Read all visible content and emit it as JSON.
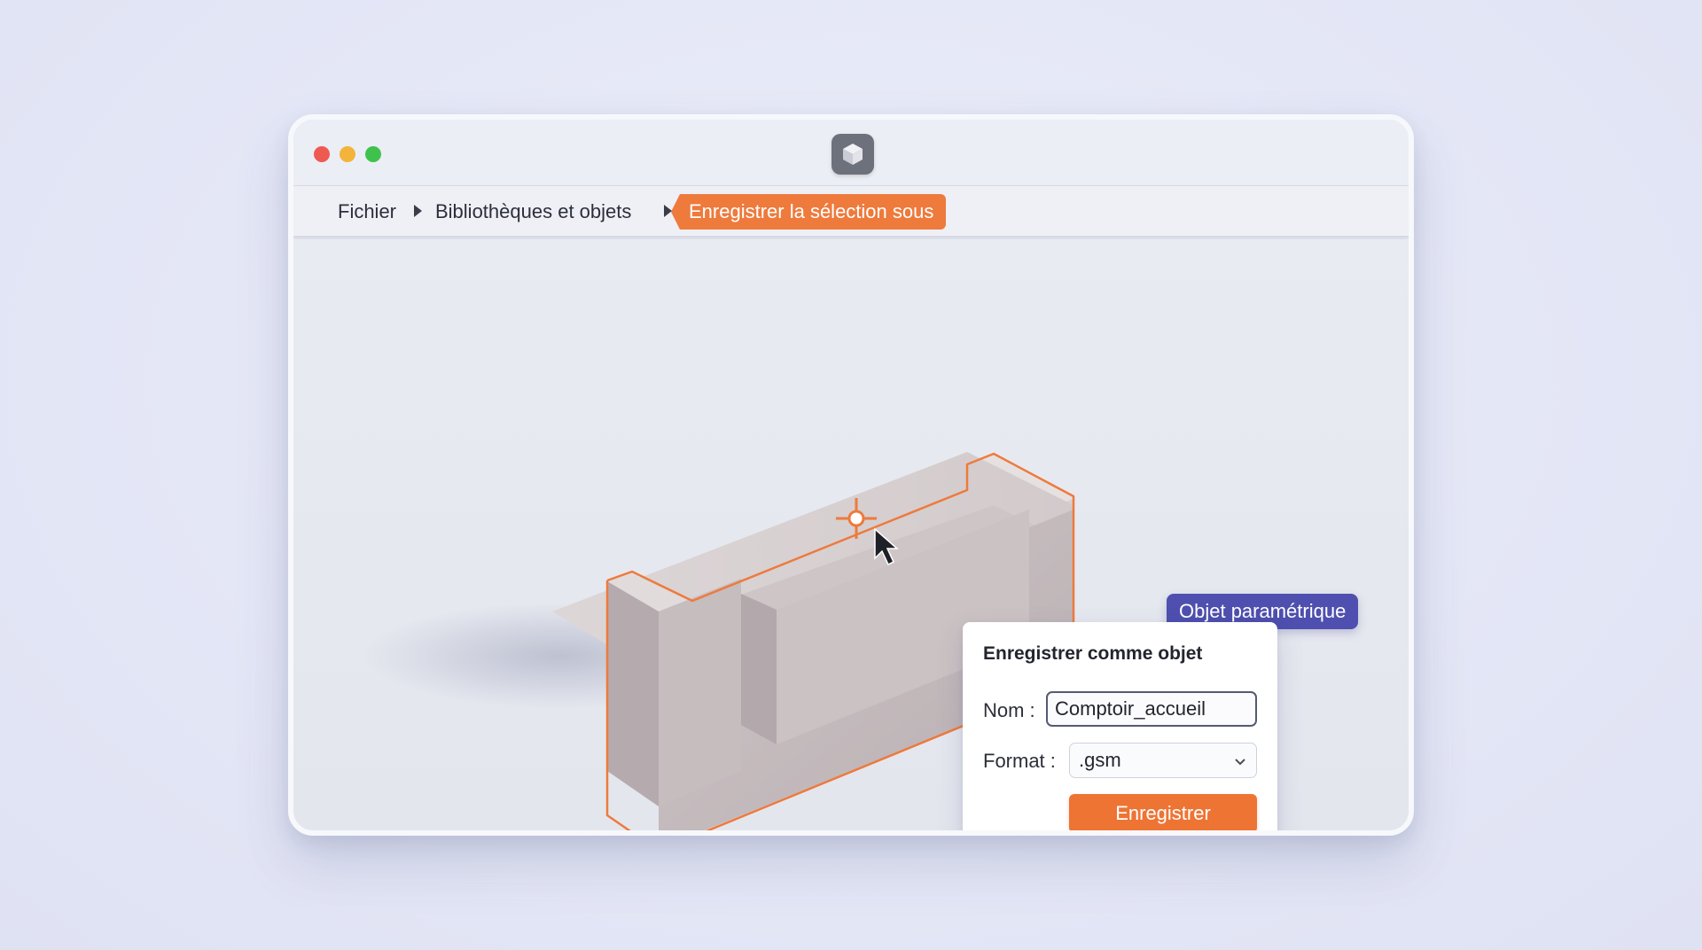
{
  "window": {
    "controls": [
      "close",
      "minimize",
      "maximize"
    ],
    "app_icon": "cube-icon"
  },
  "breadcrumb": {
    "items": [
      "Fichier",
      "Bibliothèques et objets"
    ],
    "active": "Enregistrer la sélection sous",
    "separator_icon": "caret-right-icon"
  },
  "viewport": {
    "badge": "Objet paramétrique",
    "cursor_icon": "arrow-cursor-icon",
    "target_icon": "crosshair-icon"
  },
  "dialog": {
    "title": "Enregistrer comme objet",
    "name_label": "Nom :",
    "name_value": "Comptoir_accueil",
    "format_label": "Format :",
    "format_value": ".gsm",
    "save_label": "Enregistrer"
  },
  "colors": {
    "accent": "#ee7a3c",
    "badge": "#4e4fae",
    "selection_outline": "#ee7a3c"
  }
}
